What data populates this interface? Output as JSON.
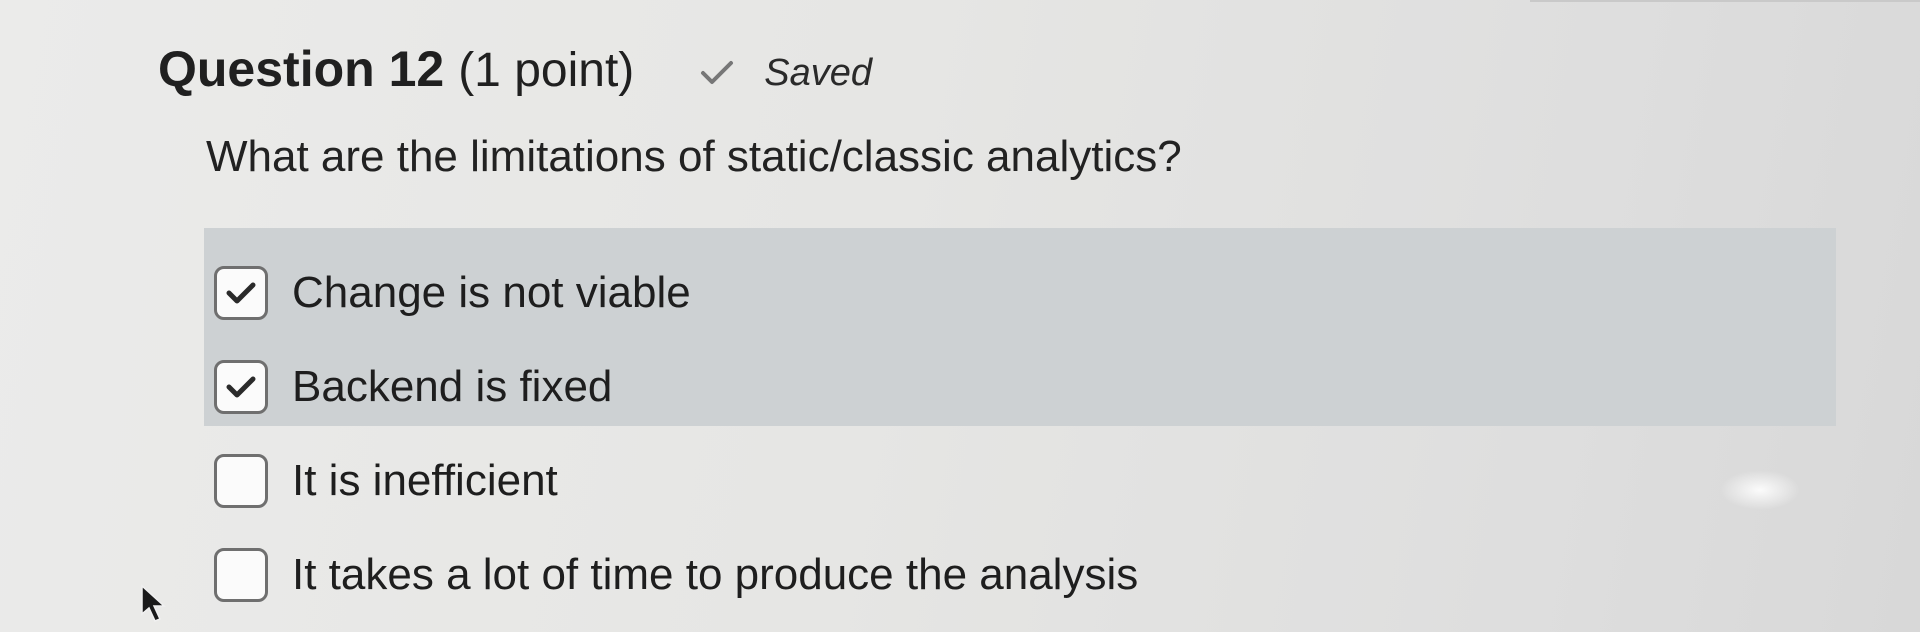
{
  "question": {
    "title": "Question 12",
    "points": "(1 point)",
    "status": "Saved",
    "status_icon": "check-icon",
    "prompt": "What are the limitations of static/classic analytics?"
  },
  "options": [
    {
      "label": "Change is not viable",
      "checked": true
    },
    {
      "label": "Backend is fixed",
      "checked": true
    },
    {
      "label": "It is inefficient",
      "checked": false
    },
    {
      "label": "It takes a lot of time to produce the analysis",
      "checked": false
    }
  ],
  "colors": {
    "selected_band": "#cdd1d3",
    "background": "#e8e8e6",
    "checkmark": "#2a2a2a"
  }
}
